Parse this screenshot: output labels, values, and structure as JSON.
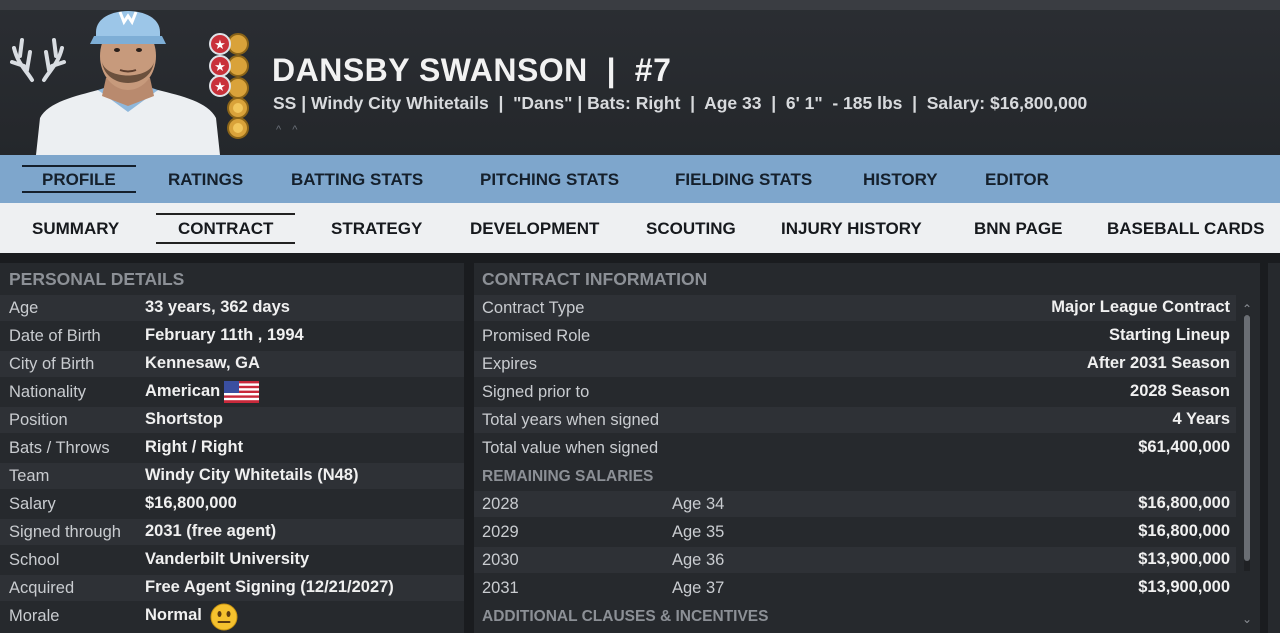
{
  "player": {
    "name_line": "DANSBY SWANSON  |  #7",
    "sub_line": "SS | Windy City Whitetails  |  \"Dans\" | Bats: Right  |  Age 33  |  6' 1\"  - 185 lbs  |  Salary: $16,800,000",
    "arrows": "^ ^"
  },
  "nav_primary": [
    {
      "label": "PROFILE",
      "active": true
    },
    {
      "label": "RATINGS",
      "active": false
    },
    {
      "label": "BATTING STATS",
      "active": false
    },
    {
      "label": "PITCHING STATS",
      "active": false
    },
    {
      "label": "FIELDING STATS",
      "active": false
    },
    {
      "label": "HISTORY",
      "active": false
    },
    {
      "label": "EDITOR",
      "active": false
    }
  ],
  "nav_secondary": [
    {
      "label": "SUMMARY",
      "active": false
    },
    {
      "label": "CONTRACT",
      "active": true
    },
    {
      "label": "STRATEGY",
      "active": false
    },
    {
      "label": "DEVELOPMENT",
      "active": false
    },
    {
      "label": "SCOUTING",
      "active": false
    },
    {
      "label": "INJURY HISTORY",
      "active": false
    },
    {
      "label": "BNN PAGE",
      "active": false
    },
    {
      "label": "BASEBALL CARDS",
      "active": false
    }
  ],
  "personal": {
    "title": "PERSONAL DETAILS",
    "rows": [
      {
        "label": "Age",
        "value": "33 years, 362 days"
      },
      {
        "label": "Date of Birth",
        "value": "February 11th , 1994"
      },
      {
        "label": "City of Birth",
        "value": "Kennesaw, GA"
      },
      {
        "label": "Nationality",
        "value": "American"
      },
      {
        "label": "Position",
        "value": "Shortstop"
      },
      {
        "label": "Bats / Throws",
        "value": "Right / Right"
      },
      {
        "label": "Team",
        "value": "Windy City Whitetails (N48)"
      },
      {
        "label": "Salary",
        "value": "$16,800,000"
      },
      {
        "label": "Signed through",
        "value": "2031 (free agent)"
      },
      {
        "label": "School",
        "value": "Vanderbilt University"
      },
      {
        "label": "Acquired",
        "value": "Free Agent Signing (12/21/2027)"
      },
      {
        "label": "Morale",
        "value": "Normal"
      }
    ]
  },
  "contract": {
    "title": "CONTRACT INFORMATION",
    "rows": [
      {
        "label": "Contract Type",
        "value": "Major League Contract"
      },
      {
        "label": "Promised Role",
        "value": "Starting Lineup"
      },
      {
        "label": "Expires",
        "value": "After 2031 Season"
      },
      {
        "label": "Signed prior to",
        "value": "2028 Season"
      },
      {
        "label": "Total years when signed",
        "value": "4 Years"
      },
      {
        "label": "Total value when signed",
        "value": "$61,400,000"
      }
    ],
    "remaining_title": "REMAINING SALARIES",
    "salaries": [
      {
        "year": "2028",
        "age": "Age 34",
        "amount": "$16,800,000"
      },
      {
        "year": "2029",
        "age": "Age 35",
        "amount": "$16,800,000"
      },
      {
        "year": "2030",
        "age": "Age 36",
        "amount": "$13,900,000"
      },
      {
        "year": "2031",
        "age": "Age 37",
        "amount": "$13,900,000"
      }
    ],
    "clauses_title": "ADDITIONAL CLAUSES & INCENTIVES"
  },
  "colors": {
    "nav_primary_bg": "#7ea6cc",
    "nav_secondary_bg": "#eef0f2",
    "panel_bg": "#26292d",
    "cap_blue": "#9cc6e8"
  }
}
